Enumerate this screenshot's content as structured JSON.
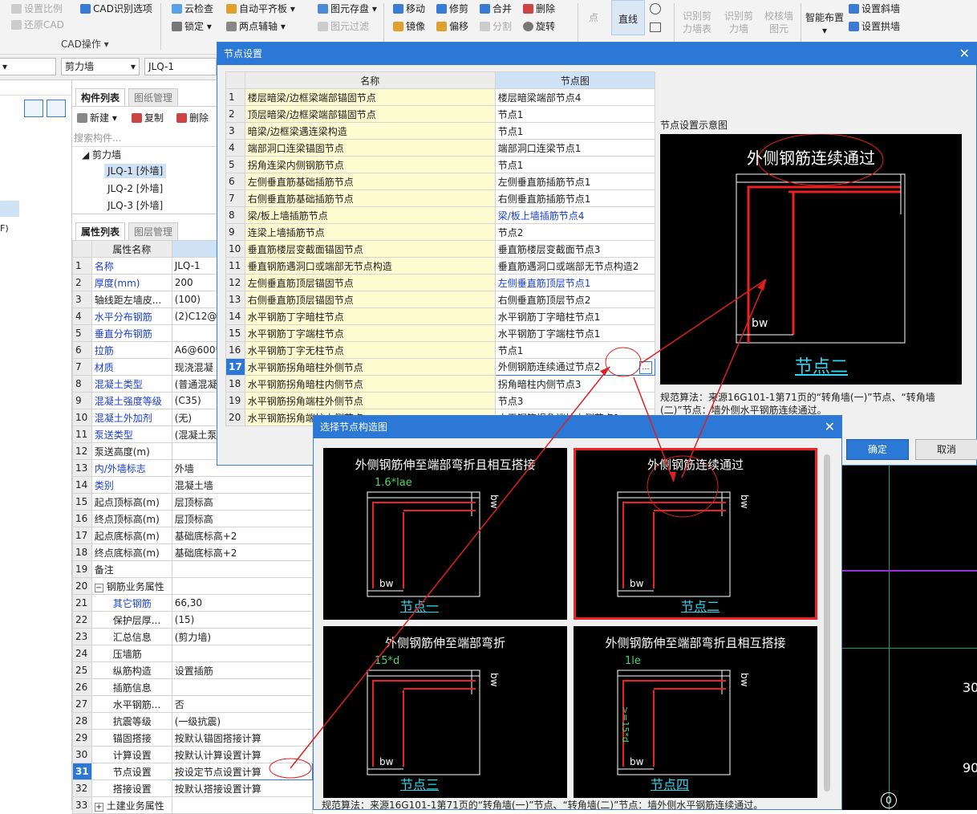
{
  "toolbar": {
    "g1": [
      "设置比例",
      "还原CAD"
    ],
    "g1b": "CAD识别选项",
    "group_label": "CAD操作",
    "g2": [
      "云检查",
      "锁定"
    ],
    "g3": [
      "自动平齐板",
      "两点辅轴"
    ],
    "g4": [
      "图元存盘",
      "图元过滤"
    ],
    "g5": [
      "移动",
      "镜像"
    ],
    "g6": [
      "修剪",
      "偏移"
    ],
    "g7": [
      "合并",
      "分割"
    ],
    "g8": [
      "删除",
      "旋转"
    ],
    "point": "点",
    "line": "直线",
    "recog": [
      "识别剪力墙表",
      "识别剪力墙",
      "校核墙图元"
    ],
    "smart": "智能布置",
    "right": [
      "设置斜墙",
      "设置拱墙"
    ]
  },
  "selector": {
    "type": "剪力墙",
    "name": "JLQ-1"
  },
  "component_panel": {
    "tabs": [
      "构件列表",
      "图纸管理"
    ],
    "actions": [
      "新建",
      "复制",
      "删除"
    ],
    "search_placeholder": "搜索构件...",
    "tree_root": "剪力墙",
    "tree_items": [
      "JLQ-1 [外墙]",
      "JLQ-2 [外墙]",
      "JLQ-3 [外墙]"
    ]
  },
  "attr_panel": {
    "tabs": [
      "属性列表",
      "图层管理"
    ],
    "header": "属性名称",
    "rows": [
      {
        "n": "1",
        "k": "名称",
        "v": "JLQ-1",
        "b": true
      },
      {
        "n": "2",
        "k": "厚度(mm)",
        "v": "200",
        "b": true
      },
      {
        "n": "3",
        "k": "轴线距左墙皮...",
        "v": "(100)",
        "b": false
      },
      {
        "n": "4",
        "k": "水平分布钢筋",
        "v": "(2)C12@2",
        "b": true
      },
      {
        "n": "5",
        "k": "垂直分布钢筋",
        "v": "",
        "b": true
      },
      {
        "n": "6",
        "k": "拉筋",
        "v": "A6@600*",
        "b": true
      },
      {
        "n": "7",
        "k": "材质",
        "v": "现浇混凝",
        "b": true
      },
      {
        "n": "8",
        "k": "混凝土类型",
        "v": "(普通混凝",
        "b": true
      },
      {
        "n": "9",
        "k": "混凝土强度等级",
        "v": "(C35)",
        "b": true
      },
      {
        "n": "10",
        "k": "混凝土外加剂",
        "v": "(无)",
        "b": true
      },
      {
        "n": "11",
        "k": "泵送类型",
        "v": "(混凝土泵",
        "b": true
      },
      {
        "n": "12",
        "k": "泵送高度(m)",
        "v": "",
        "b": false
      },
      {
        "n": "13",
        "k": "内/外墙标志",
        "v": "外墙",
        "b": true
      },
      {
        "n": "14",
        "k": "类别",
        "v": "混凝土墙",
        "b": true
      },
      {
        "n": "15",
        "k": "起点顶标高(m)",
        "v": "层顶标高",
        "b": false
      },
      {
        "n": "16",
        "k": "终点顶标高(m)",
        "v": "层顶标高",
        "b": false
      },
      {
        "n": "17",
        "k": "起点底标高(m)",
        "v": "基础底标高+2",
        "b": false
      },
      {
        "n": "18",
        "k": "终点底标高(m)",
        "v": "基础底标高+2",
        "b": false
      },
      {
        "n": "19",
        "k": "备注",
        "v": "",
        "b": false
      },
      {
        "n": "20",
        "k": "钢筋业务属性",
        "v": "",
        "b": false,
        "g": "−"
      },
      {
        "n": "21",
        "k": "其它钢筋",
        "v": "66,30",
        "b": true,
        "i": true
      },
      {
        "n": "22",
        "k": "保护层厚...",
        "v": "(15)",
        "b": false,
        "i": true
      },
      {
        "n": "23",
        "k": "汇总信息",
        "v": "(剪力墙)",
        "b": false,
        "i": true
      },
      {
        "n": "24",
        "k": "压墙筋",
        "v": "",
        "b": false,
        "i": true
      },
      {
        "n": "25",
        "k": "纵筋构造",
        "v": "设置插筋",
        "b": false,
        "i": true
      },
      {
        "n": "26",
        "k": "插筋信息",
        "v": "",
        "b": false,
        "i": true
      },
      {
        "n": "27",
        "k": "水平钢筋...",
        "v": "否",
        "b": false,
        "i": true
      },
      {
        "n": "28",
        "k": "抗震等级",
        "v": "(一级抗震)",
        "b": false,
        "i": true
      },
      {
        "n": "29",
        "k": "锚固搭接",
        "v": "按默认锚固搭接计算",
        "b": false,
        "i": true
      },
      {
        "n": "30",
        "k": "计算设置",
        "v": "按默认计算设置计算",
        "b": false,
        "i": true
      },
      {
        "n": "31",
        "k": "节点设置",
        "v": "按设定节点设置计算",
        "b": false,
        "i": true,
        "s": true
      },
      {
        "n": "32",
        "k": "搭接设置",
        "v": "按默认搭接设置计算",
        "b": false,
        "i": true
      },
      {
        "n": "33",
        "k": "土建业务属性",
        "v": "",
        "b": false,
        "g": "+"
      }
    ]
  },
  "node_dialog": {
    "title": "节点设置",
    "col_name": "名称",
    "col_node": "节点图",
    "rows": [
      {
        "n": "1",
        "name": "楼层暗梁/边框梁端部锚固节点",
        "node": "楼层暗梁端部节点4"
      },
      {
        "n": "2",
        "name": "顶层暗梁/边框梁端部锚固节点",
        "node": "节点1"
      },
      {
        "n": "3",
        "name": "暗梁/边框梁遇连梁构造",
        "node": "节点1"
      },
      {
        "n": "4",
        "name": "端部洞口连梁锚固节点",
        "node": "端部洞口连梁节点1"
      },
      {
        "n": "5",
        "name": "拐角连梁内侧钢筋节点",
        "node": "节点1"
      },
      {
        "n": "6",
        "name": "左侧垂直筋基础插筋节点",
        "node": "左侧垂直筋插筋节点1"
      },
      {
        "n": "7",
        "name": "右侧垂直筋基础插筋节点",
        "node": "右侧垂直筋插筋节点1"
      },
      {
        "n": "8",
        "name": "梁/板上墙插筋节点",
        "node": "梁/板上墙插筋节点4",
        "b": true
      },
      {
        "n": "9",
        "name": "连梁上墙插筋节点",
        "node": "节点2"
      },
      {
        "n": "10",
        "name": "垂直筋楼层变截面锚固节点",
        "node": "垂直筋楼层变截面节点3"
      },
      {
        "n": "11",
        "name": "垂直钢筋遇洞口或端部无节点构造",
        "node": "垂直筋遇洞口或端部无节点构造2"
      },
      {
        "n": "12",
        "name": "左侧垂直筋顶层锚固节点",
        "node": "左侧垂直筋顶层节点1",
        "b": true
      },
      {
        "n": "13",
        "name": "右侧垂直筋顶层锚固节点",
        "node": "右侧垂直筋顶层节点2"
      },
      {
        "n": "14",
        "name": "水平钢筋丁字暗柱节点",
        "node": "水平钢筋丁字暗柱节点1"
      },
      {
        "n": "15",
        "name": "水平钢筋丁字端柱节点",
        "node": "水平钢筋丁字端柱节点1"
      },
      {
        "n": "16",
        "name": "水平钢筋丁字无柱节点",
        "node": "节点1"
      },
      {
        "n": "17",
        "name": "水平钢筋拐角暗柱外侧节点",
        "node": "外侧钢筋连续通过节点2",
        "sel": true
      },
      {
        "n": "18",
        "name": "水平钢筋拐角暗柱内侧节点",
        "node": "拐角暗柱内侧节点3"
      },
      {
        "n": "19",
        "name": "水平钢筋拐角端柱外侧节点",
        "node": "节点3"
      },
      {
        "n": "20",
        "name": "水平钢筋拐角端柱内侧节点",
        "node": "水平钢筋拐角端柱内侧节点1"
      }
    ],
    "preview_label": "节点设置示意图",
    "preview_title": "外侧钢筋连续通过",
    "preview_node": "节点二",
    "preview_bw": "bw",
    "desc": "规范算法：来源16G101-1第71页的“转角墙(一)”节点、“转角墙(二)”节点：墙外侧水平钢筋连续通过。",
    "ok": "确定",
    "cancel": "取消"
  },
  "choose_dialog": {
    "title": "选择节点构造图",
    "options": [
      {
        "title": "外侧钢筋伸至端部弯折且相互搭接",
        "dim": "1.6*lae",
        "label": "节点一"
      },
      {
        "title": "外侧钢筋连续通过",
        "dim": "",
        "label": "节点二"
      },
      {
        "title": "外侧钢筋伸至端部弯折",
        "dim": "15*d",
        "label": "节点三"
      },
      {
        "title": "外侧钢筋伸至端部弯折且相互搭接",
        "dim": "1le",
        "label": "节点四",
        "vdim": ">=15*d"
      }
    ],
    "bw": "bw",
    "desc": "规范算法：来源16G101-1第71页的“转角墙(一)”节点、“转角墙(二)”节点：墙外侧水平钢筋连续通过。"
  },
  "canvas": {
    "labels": [
      "300",
      "900",
      "0"
    ]
  },
  "left_edge": {
    "f": "F)"
  },
  "colors": {
    "accent": "#2b78d6",
    "annotation": "#e02020",
    "cad_cyan": "#32d6f0"
  }
}
